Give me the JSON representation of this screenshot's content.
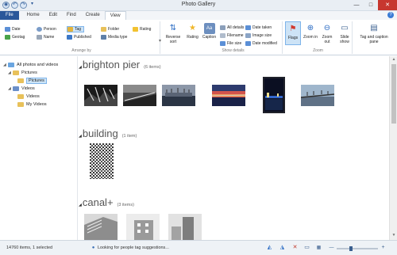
{
  "window": {
    "title": "Photo Gallery"
  },
  "qat": [
    "◉",
    "↶",
    "↷",
    "▾"
  ],
  "tabs": [
    "File",
    "Home",
    "Edit",
    "Find",
    "Create",
    "View"
  ],
  "help": "?",
  "ribbon": {
    "arrange_by": {
      "label": "Arrange by",
      "items": [
        "Date",
        "Geotag",
        "Person",
        "Name",
        "Tag",
        "Published",
        "Folder",
        "Media type",
        "Rating"
      ]
    },
    "reverse_sort": "Reverse sort",
    "show_details": {
      "label": "Show details",
      "items": [
        "Rating",
        "Caption",
        "All details",
        "Filename",
        "File size",
        "Date taken",
        "Image size",
        "Date modified"
      ]
    },
    "zoom": {
      "label": "Zoom",
      "items": [
        "Flags",
        "Zoom in",
        "Zoom out",
        "Slide show",
        "Tag and caption pane"
      ]
    }
  },
  "nav": {
    "items": [
      {
        "label": "All photos and videos",
        "indent": 0,
        "selected": false
      },
      {
        "label": "Pictures",
        "indent": 1,
        "selected": false
      },
      {
        "label": "Pictures",
        "indent": 2,
        "selected": true
      },
      {
        "label": "Videos",
        "indent": 1,
        "selected": false
      },
      {
        "label": "Videos",
        "indent": 2,
        "selected": false
      },
      {
        "label": "My Videos",
        "indent": 2,
        "selected": false
      }
    ]
  },
  "groups": [
    {
      "title": "brighton pier",
      "count": "(6 items)"
    },
    {
      "title": "building",
      "count": "(1 item)"
    },
    {
      "title": "canal+",
      "count": "(3 items)"
    }
  ],
  "status": {
    "items_text": "14760 items, 1 selected",
    "people_text": "Looking for people tag suggestions..."
  }
}
